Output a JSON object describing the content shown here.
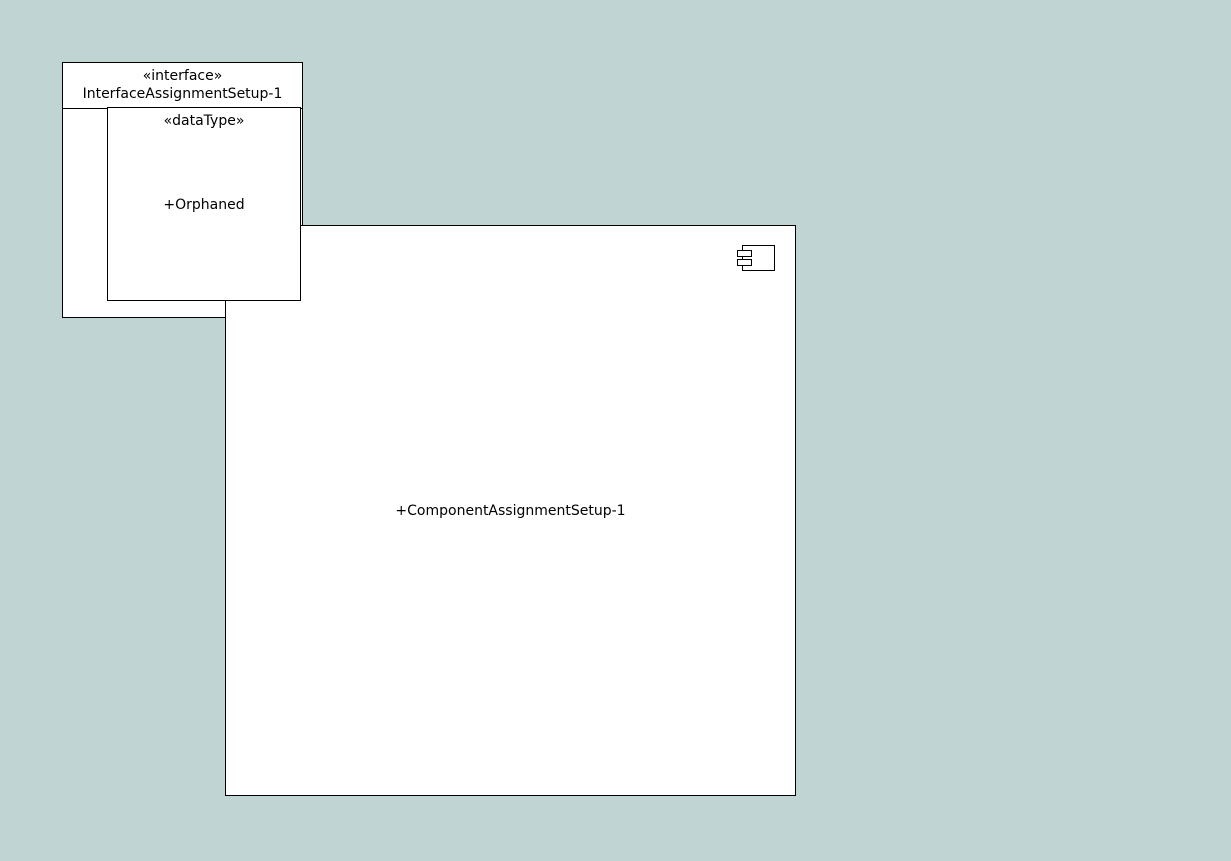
{
  "colors": {
    "background": "#bfd4d3",
    "element_fill": "#ffffff",
    "stroke": "#000000"
  },
  "interface": {
    "stereotype": "«interface»",
    "name": "InterfaceAssignmentSetup-1"
  },
  "data_type": {
    "stereotype": "«dataType»",
    "name": "+Orphaned"
  },
  "component": {
    "icon": "component-icon",
    "name": "+ComponentAssignmentSetup-1"
  }
}
